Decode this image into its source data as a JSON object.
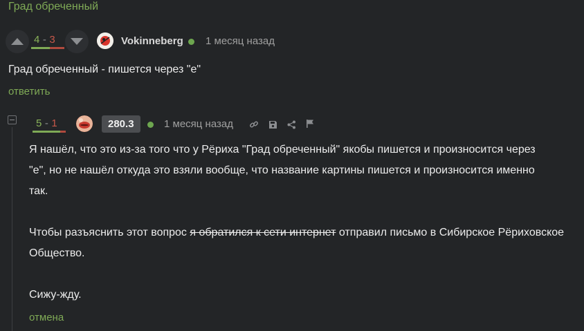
{
  "story": {
    "title": "Град обреченный"
  },
  "comment1": {
    "rating_plus": "4",
    "rating_minus": "3",
    "rating_sep": "-",
    "plus_fraction": 0.57,
    "username": "Vokinneberg",
    "time": "1 месяц назад",
    "text": "Град обреченный - пишется через \"е\"",
    "reply_label": "ответить"
  },
  "comment2": {
    "rating_plus": "5",
    "rating_minus": "1",
    "rating_sep": "-",
    "plus_fraction": 0.83,
    "user_rating": "280.3",
    "time": "1 месяц назад",
    "para1": "Я нашёл, что это из-за того что у Рёриха \"Град обреченный\" якобы пишется и произносится через \"е\", но не нашёл откуда это взяли вообще, что название картины пишется и произносится именно так.",
    "para2_before": "Чтобы разъяснить этот вопрос ",
    "para2_strike": "я обратился к сети интернет",
    "para2_after": " отправил письмо в Сибирское Рёриховское Общество.",
    "para3": "Сижу-жду.",
    "cancel_label": "отмена"
  },
  "icons": [
    "arrow-up-icon",
    "arrow-down-icon",
    "link-icon",
    "save-icon",
    "share-icon",
    "flag-icon",
    "collapse-icon"
  ],
  "colors": {
    "background": "#232527",
    "accent_green": "#7faa56",
    "minus_red": "#c7584a",
    "badge_bg": "#4b4d50"
  }
}
